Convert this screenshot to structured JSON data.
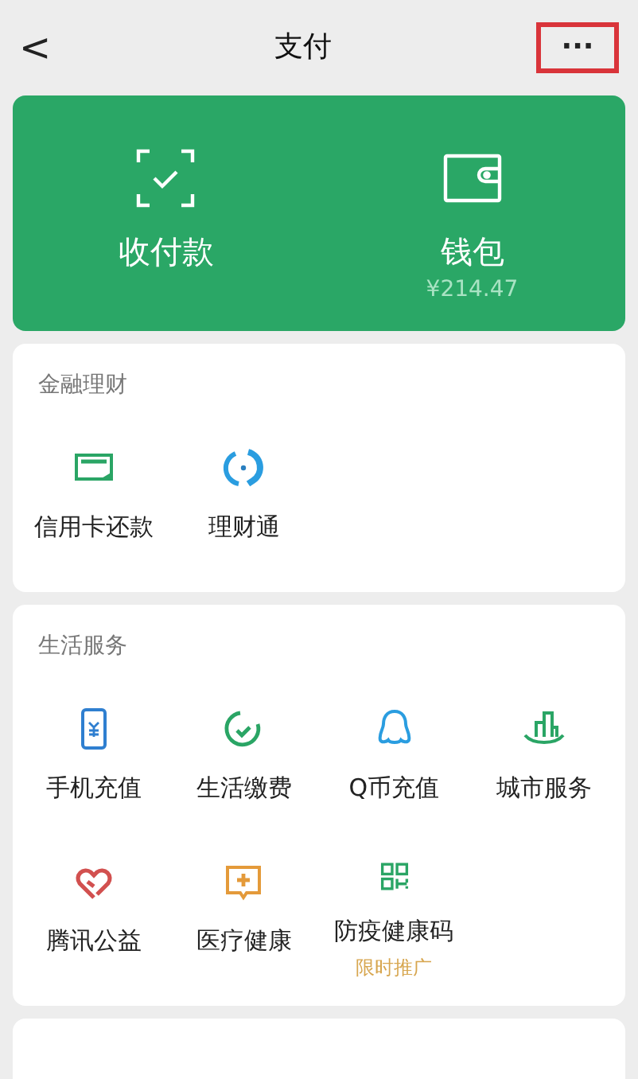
{
  "header": {
    "back": "<",
    "title": "支付",
    "more": "···",
    "more_highlighted": true
  },
  "top_card": {
    "items": [
      {
        "kind": "scan",
        "label": "收付款"
      },
      {
        "kind": "wallet",
        "label": "钱包",
        "sub": "¥214.47"
      }
    ]
  },
  "sections": [
    {
      "title": "金融理财",
      "items": [
        {
          "kind": "card",
          "label": "信用卡还款"
        },
        {
          "kind": "fund",
          "label": "理财通"
        }
      ]
    },
    {
      "title": "生活服务",
      "items": [
        {
          "kind": "phone",
          "label": "手机充值"
        },
        {
          "kind": "bill",
          "label": "生活缴费"
        },
        {
          "kind": "penguin",
          "label": "Q币充值"
        },
        {
          "kind": "city",
          "label": "城市服务"
        },
        {
          "kind": "heart",
          "label": "腾讯公益"
        },
        {
          "kind": "medical",
          "label": "医疗健康"
        },
        {
          "kind": "qr",
          "label": "防疫健康码",
          "tag": "限时推广"
        }
      ]
    }
  ]
}
